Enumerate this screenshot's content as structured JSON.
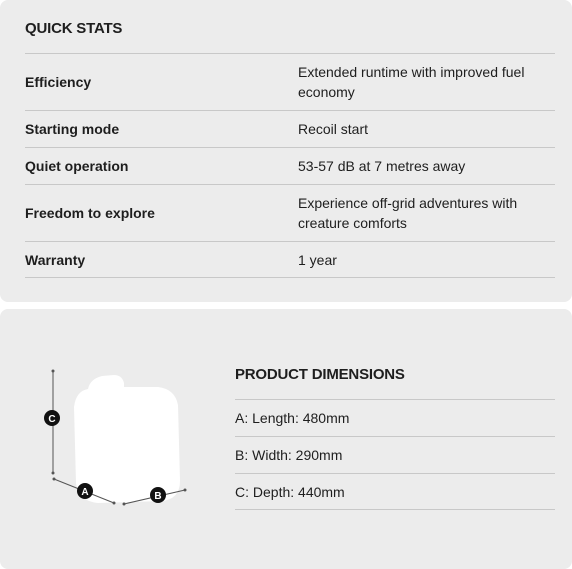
{
  "quick_stats": {
    "title": "QUICK STATS",
    "rows": [
      {
        "label": "Efficiency",
        "value": "Extended runtime with improved fuel economy"
      },
      {
        "label": "Starting mode",
        "value": "Recoil start"
      },
      {
        "label": "Quiet operation",
        "value": "53-57 dB at 7 metres away"
      },
      {
        "label": "Freedom to explore",
        "value": "Experience off-grid adventures with creature comforts"
      },
      {
        "label": "Warranty",
        "value": "1 year"
      }
    ]
  },
  "dimensions": {
    "title": "PRODUCT DIMENSIONS",
    "items": [
      "A: Length: 480mm",
      "B: Width: 290mm",
      "C: Depth: 440mm"
    ],
    "markers": {
      "a": "A",
      "b": "B",
      "c": "C"
    }
  }
}
